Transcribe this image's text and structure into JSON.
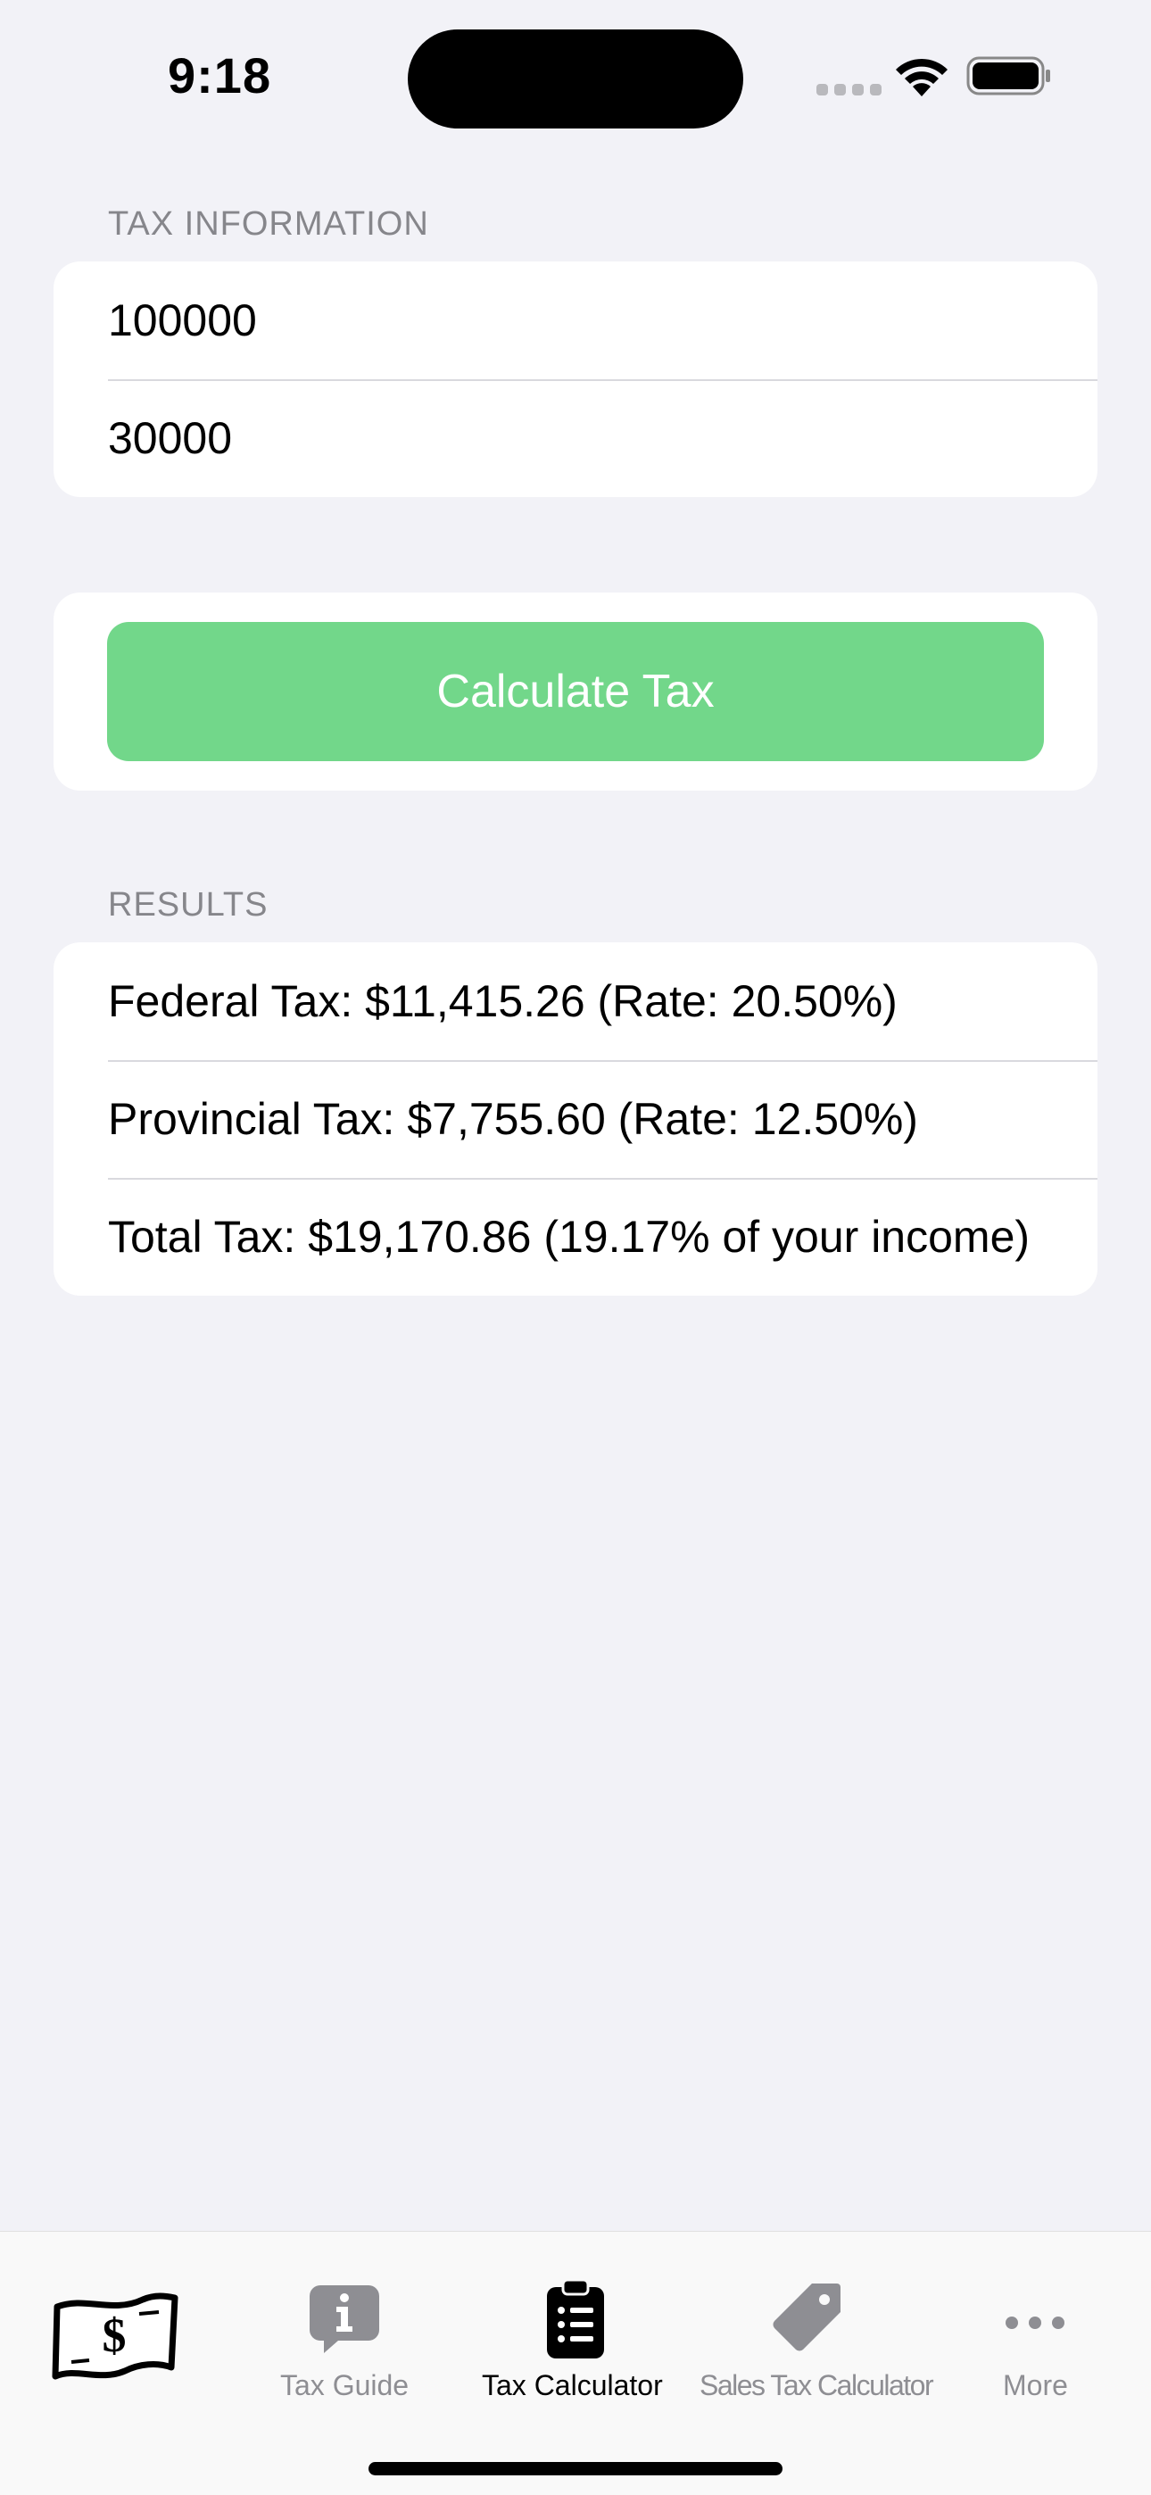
{
  "status_bar": {
    "time": "9:18"
  },
  "tax_information": {
    "header": "TAX INFORMATION",
    "income_value": "100000",
    "second_value": "30000"
  },
  "actions": {
    "calculate_label": "Calculate Tax",
    "button_color": "#72d78a"
  },
  "results": {
    "header": "RESULTS",
    "federal": "Federal Tax: $11,415.26 (Rate: 20.50%)",
    "provincial": "Provincial Tax: $7,755.60 (Rate: 12.50%)",
    "total": "Total Tax: $19,170.86 (19.17% of your income)"
  },
  "tab_bar": {
    "tabs": [
      {
        "label": "",
        "icon": "dollar-bill-icon",
        "active": false
      },
      {
        "label": "Tax Guide",
        "icon": "info-bubble-icon",
        "active": false
      },
      {
        "label": "Tax Calculator",
        "icon": "clipboard-list-icon",
        "active": true
      },
      {
        "label": "Sales Tax Calculator",
        "icon": "price-tag-icon",
        "active": false
      },
      {
        "label": "More",
        "icon": "ellipsis-icon",
        "active": false
      }
    ]
  },
  "colors": {
    "background": "#f2f2f7",
    "section_header": "#86868b",
    "inactive_tab": "#8e8e93"
  }
}
